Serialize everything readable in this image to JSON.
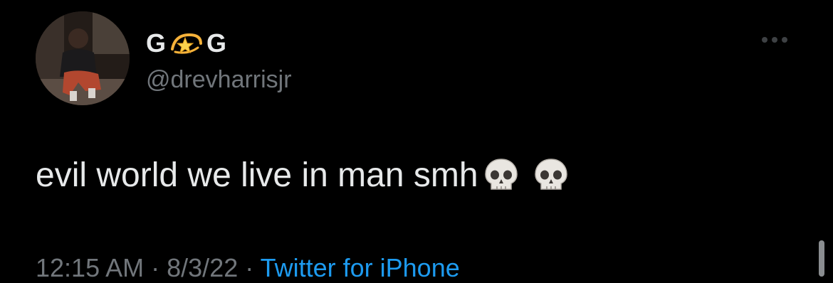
{
  "tweet": {
    "display_name_part1": "G",
    "display_name_emoji": "dizzy-star-icon",
    "display_name_part2": "G",
    "handle": "@drevharrisjr",
    "text": "evil world we live in man smh",
    "emojis": [
      "skull-icon",
      "skull-icon"
    ],
    "time": "12:15 AM",
    "separator": "·",
    "date": "8/3/22",
    "source": "Twitter for iPhone"
  },
  "colors": {
    "background": "#000000",
    "primary_text": "#e7e9ea",
    "secondary_text": "#71767b",
    "link": "#1d9bf0"
  }
}
